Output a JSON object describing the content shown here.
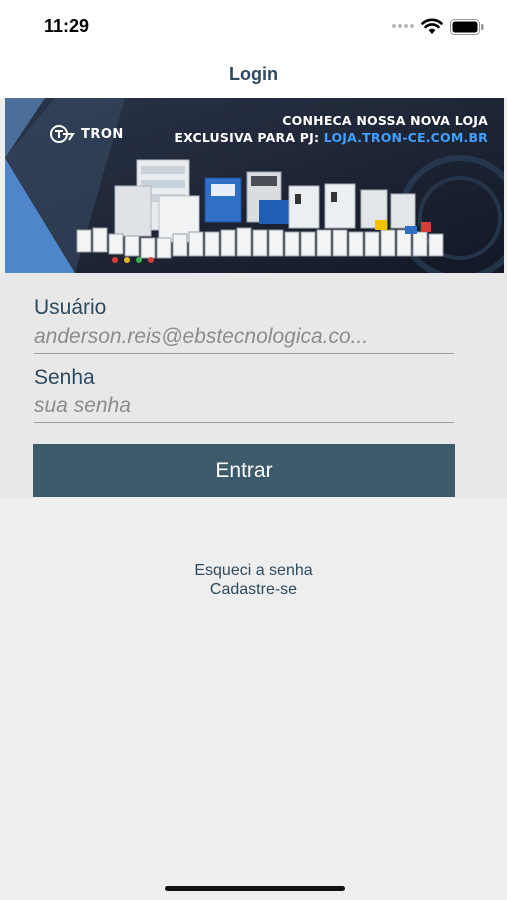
{
  "status_bar": {
    "time": "11:29"
  },
  "nav": {
    "title": "Login"
  },
  "banner": {
    "brand_name": "TRON",
    "promo_line1": "CONHECA NOSSA NOVA LOJA",
    "promo_line2_prefix": "EXCLUSIVA PARA PJ: ",
    "promo_url": "LOJA.TRON-CE.COM.BR"
  },
  "form": {
    "user_label": "Usuário",
    "user_value": "anderson.reis@ebstecnologica.co...",
    "password_label": "Senha",
    "password_placeholder": "sua senha",
    "submit_label": "Entrar"
  },
  "links": {
    "forgot_password": "Esqueci a senha",
    "register": "Cadastre-se"
  },
  "colors": {
    "accent": "#3c5a6a",
    "title": "#2c4a60",
    "background": "#eeeeee"
  }
}
